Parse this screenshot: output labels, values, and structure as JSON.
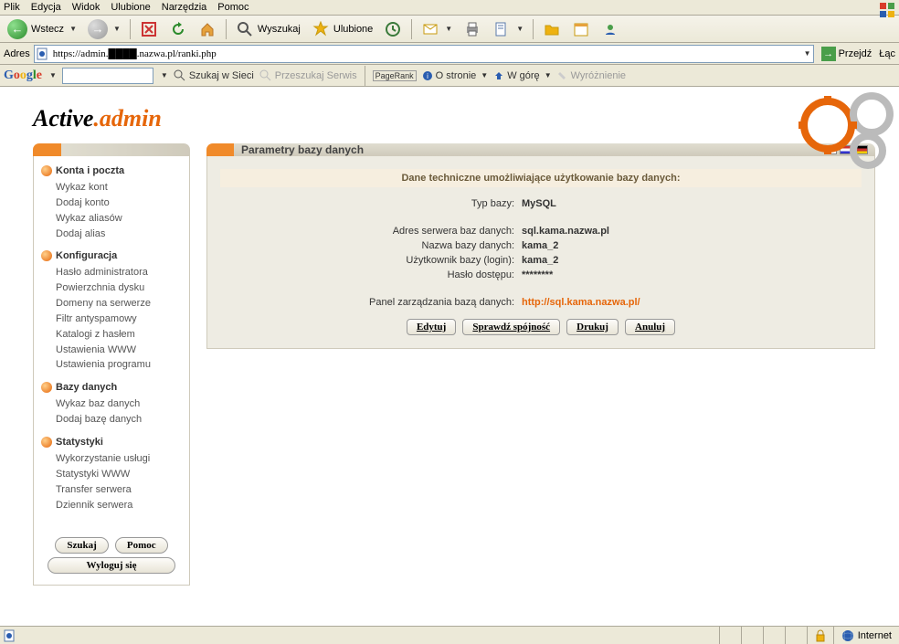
{
  "menu": {
    "items": [
      "Plik",
      "Edycja",
      "Widok",
      "Ulubione",
      "Narzędzia",
      "Pomoc"
    ]
  },
  "toolbar": {
    "back": "Wstecz",
    "search": "Wyszukaj",
    "fav": "Ulubione"
  },
  "address": {
    "label": "Adres",
    "url": "https://admin.████.nazwa.pl/ranki.php",
    "go": "Przejdź",
    "links": "Łąc"
  },
  "google": {
    "search_web": "Szukaj w Sieci",
    "search_site": "Przeszukaj Serwis",
    "pagerank": "PageRank",
    "about": "O stronie",
    "up": "W górę",
    "highlight": "Wyróżnienie"
  },
  "logo": {
    "part1": "Active",
    "part2": ".admin"
  },
  "sidebar": {
    "sections": [
      {
        "title": "Konta i poczta",
        "items": [
          "Wykaz kont",
          "Dodaj konto",
          "Wykaz aliasów",
          "Dodaj alias"
        ]
      },
      {
        "title": "Konfiguracja",
        "items": [
          "Hasło administratora",
          "Powierzchnia dysku",
          "Domeny na serwerze",
          "Filtr antyspamowy",
          "Katalogi z hasłem",
          "Ustawienia WWW",
          "Ustawienia programu"
        ]
      },
      {
        "title": "Bazy danych",
        "items": [
          "Wykaz baz danych",
          "Dodaj bazę danych"
        ]
      },
      {
        "title": "Statystyki",
        "items": [
          "Wykorzystanie usługi",
          "Statystyki WWW",
          "Transfer serwera",
          "Dziennik serwera"
        ]
      }
    ],
    "search": "Szukaj",
    "help": "Pomoc",
    "logout": "Wyloguj się"
  },
  "main": {
    "title": "Parametry bazy danych",
    "subtitle": "Dane techniczne umożliwiające użytkowanie bazy danych:",
    "rows": [
      {
        "label": "Typ bazy:",
        "value": "MySQL"
      },
      {
        "label": "Adres serwera baz danych:",
        "value": "sql.kama.nazwa.pl"
      },
      {
        "label": "Nazwa bazy danych:",
        "value": "kama_2"
      },
      {
        "label": "Użytkownik bazy (login):",
        "value": "kama_2"
      },
      {
        "label": "Hasło dostępu:",
        "value": "********"
      },
      {
        "label": "Panel zarządzania bazą danych:",
        "value": "http://sql.kama.nazwa.pl/",
        "link": true
      }
    ],
    "buttons": [
      "Edytuj",
      "Sprawdź spójność",
      "Drukuj",
      "Anuluj"
    ]
  },
  "status": {
    "zone": "Internet"
  }
}
